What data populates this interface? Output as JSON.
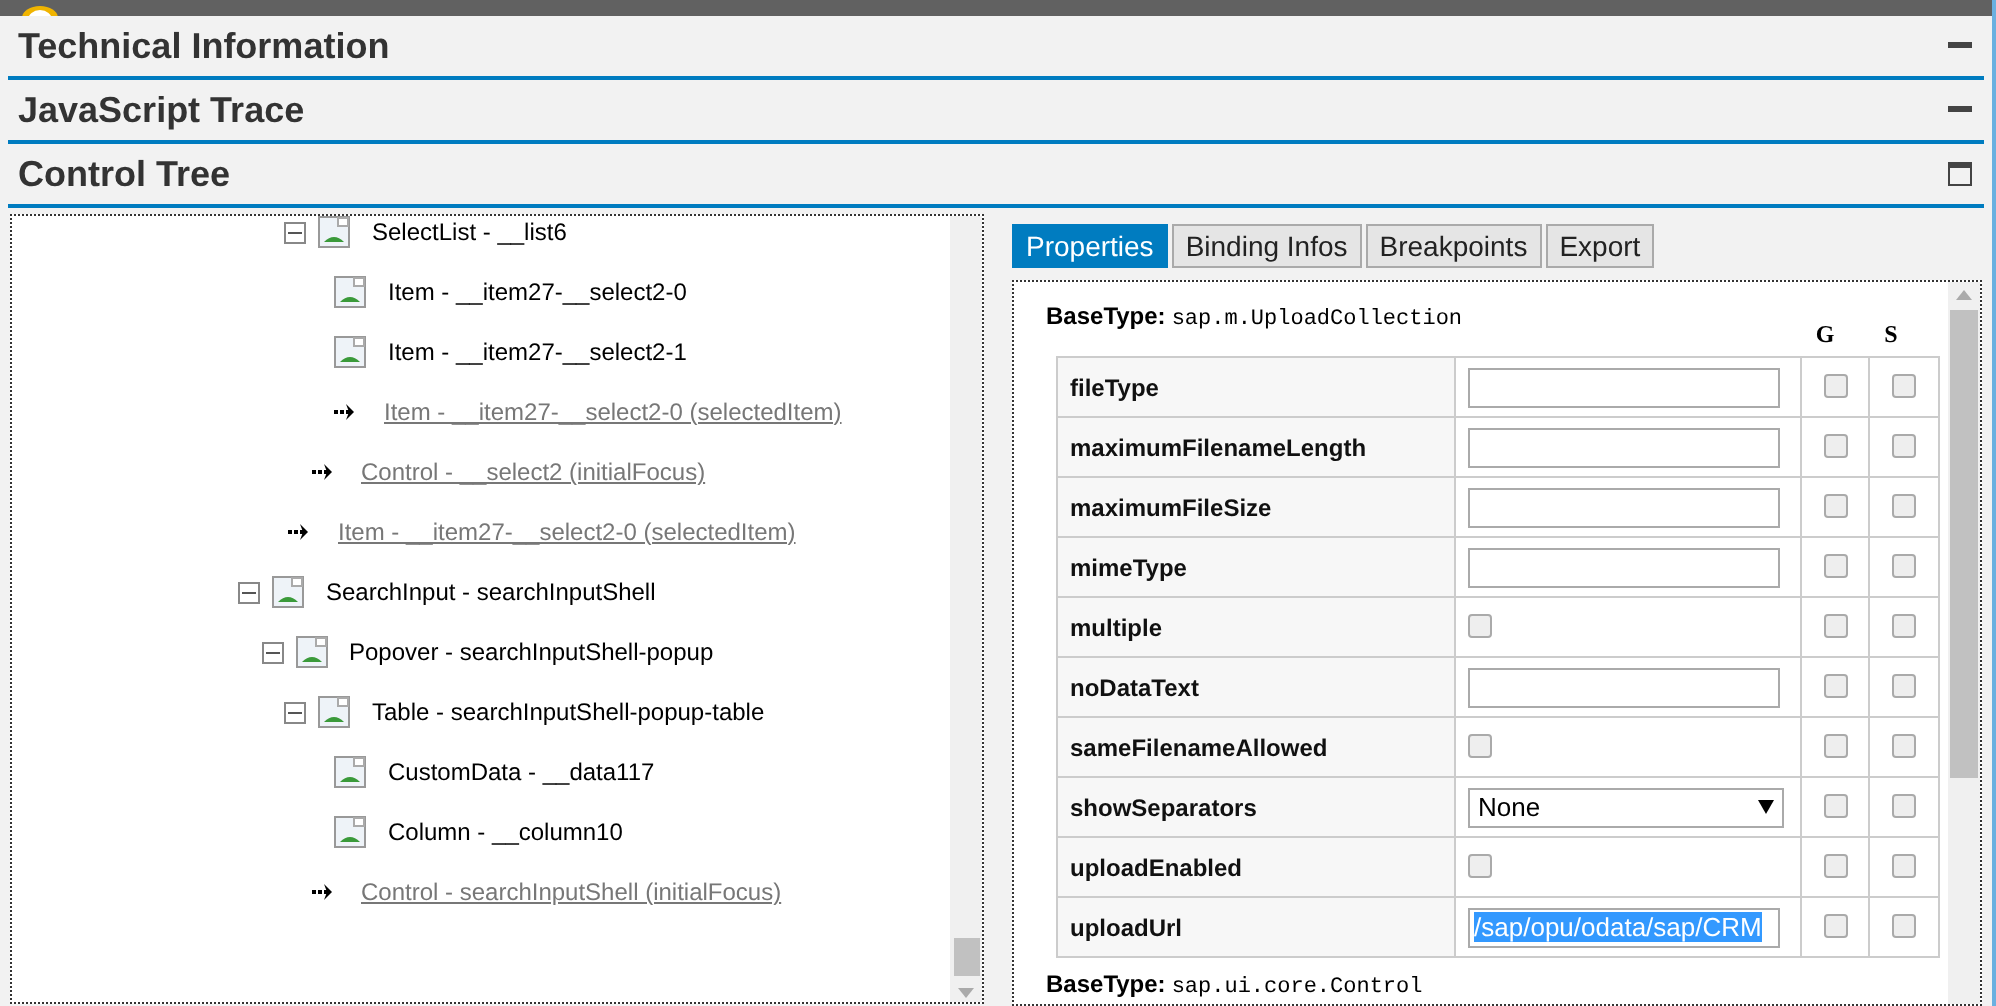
{
  "sections": [
    {
      "title": "Technical Information",
      "kind": "minimize"
    },
    {
      "title": "JavaScript Trace",
      "kind": "minimize"
    },
    {
      "title": "Control Tree",
      "kind": "restore"
    }
  ],
  "tree": {
    "items": [
      {
        "kind": "continued",
        "children": [
          {
            "kind": "continued",
            "children": [
              {
                "kind": "node",
                "label": "SelectList - __list6",
                "expanded": true,
                "children": [
                  {
                    "kind": "leaf",
                    "label": "Item - __item27-__select2-0"
                  },
                  {
                    "kind": "leaf",
                    "label": "Item - __item27-__select2-1"
                  },
                  {
                    "kind": "link",
                    "label": "Item - __item27-__select2-0 (selectedItem)"
                  }
                ]
              },
              {
                "kind": "link",
                "label": "Control - __select2 (initialFocus)"
              }
            ]
          },
          {
            "kind": "link",
            "label": "Item - __item27-__select2-0 (selectedItem)"
          }
        ]
      },
      {
        "kind": "node",
        "label": "SearchInput - searchInputShell",
        "expanded": true,
        "children": [
          {
            "kind": "node",
            "label": "Popover - searchInputShell-popup",
            "expanded": true,
            "children": [
              {
                "kind": "node",
                "label": "Table - searchInputShell-popup-table",
                "expanded": true,
                "children": [
                  {
                    "kind": "leaf",
                    "label": "CustomData - __data117"
                  },
                  {
                    "kind": "leaf",
                    "label": "Column - __column10"
                  }
                ]
              },
              {
                "kind": "link",
                "label": "Control - searchInputShell (initialFocus)"
              }
            ]
          }
        ]
      }
    ]
  },
  "tabs": [
    {
      "label": "Properties",
      "selected": true
    },
    {
      "label": "Binding Infos",
      "selected": false
    },
    {
      "label": "Breakpoints",
      "selected": false
    },
    {
      "label": "Export",
      "selected": false
    }
  ],
  "properties": {
    "base_label": "BaseType:",
    "base_type": "sap.m.UploadCollection",
    "g_header": "G",
    "s_header": "S",
    "rows": [
      {
        "name": "fileType",
        "kind": "input",
        "value": "",
        "g": false,
        "s": false
      },
      {
        "name": "maximumFilenameLength",
        "kind": "input",
        "value": "",
        "g": false,
        "s": false
      },
      {
        "name": "maximumFileSize",
        "kind": "input",
        "value": "",
        "g": false,
        "s": false
      },
      {
        "name": "mimeType",
        "kind": "input",
        "value": "",
        "g": false,
        "s": false
      },
      {
        "name": "multiple",
        "kind": "checkbox",
        "checked": false,
        "g": false,
        "s": false
      },
      {
        "name": "noDataText",
        "kind": "input",
        "value": "",
        "g": false,
        "s": false
      },
      {
        "name": "sameFilenameAllowed",
        "kind": "checkbox",
        "checked": false,
        "g": false,
        "s": false
      },
      {
        "name": "showSeparators",
        "kind": "select",
        "value": "None",
        "g": false,
        "s": false
      },
      {
        "name": "uploadEnabled",
        "kind": "checkbox",
        "checked": false,
        "g": false,
        "s": false
      },
      {
        "name": "uploadUrl",
        "kind": "input",
        "value": "/sap/opu/odata/sap/CRM",
        "highlighted": true,
        "g": false,
        "s": false
      }
    ],
    "next_base_label": "BaseType:",
    "next_base_type": "sap.ui.core.Control"
  }
}
